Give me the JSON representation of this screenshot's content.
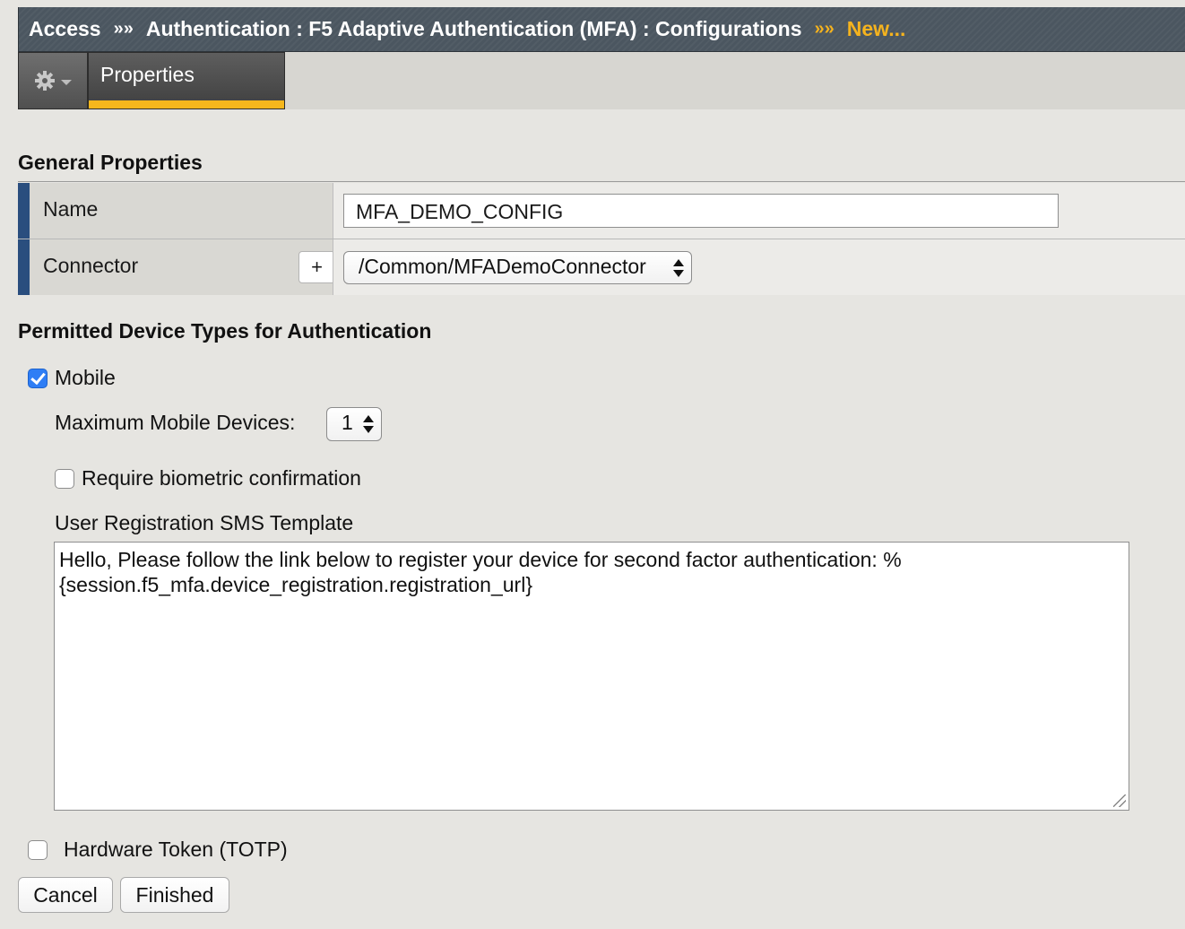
{
  "breadcrumb": {
    "items": [
      "Access",
      "Authentication : F5 Adaptive Authentication (MFA) : Configurations",
      "New..."
    ],
    "separator": "»»"
  },
  "tabs": {
    "menu_icon": "gear-icon",
    "active_label": "Properties"
  },
  "general": {
    "title": "General Properties",
    "name_label": "Name",
    "name_value": "MFA_DEMO_CONFIG",
    "connector_label": "Connector",
    "connector_add": "+",
    "connector_value": "/Common/MFADemoConnector"
  },
  "devices": {
    "title": "Permitted Device Types for Authentication",
    "mobile_label": "Mobile",
    "mobile_checked": true,
    "max_devices_label": "Maximum Mobile Devices:",
    "max_devices_value": "1",
    "biometric_label": "Require biometric confirmation",
    "biometric_checked": false,
    "sms_template_label": "User Registration SMS Template",
    "sms_template_value": "Hello, Please follow the link below to register your device for second factor authentication: %{session.f5_mfa.device_registration.registration_url}",
    "hardware_token_label": "Hardware Token (TOTP)",
    "hardware_token_checked": false
  },
  "actions": {
    "cancel": "Cancel",
    "finished": "Finished"
  },
  "colors": {
    "breadcrumb_bg": "#4b5660",
    "accent": "#f5b31e",
    "row_marker": "#2a4e7e",
    "checkbox_checked": "#2f7ef5"
  }
}
